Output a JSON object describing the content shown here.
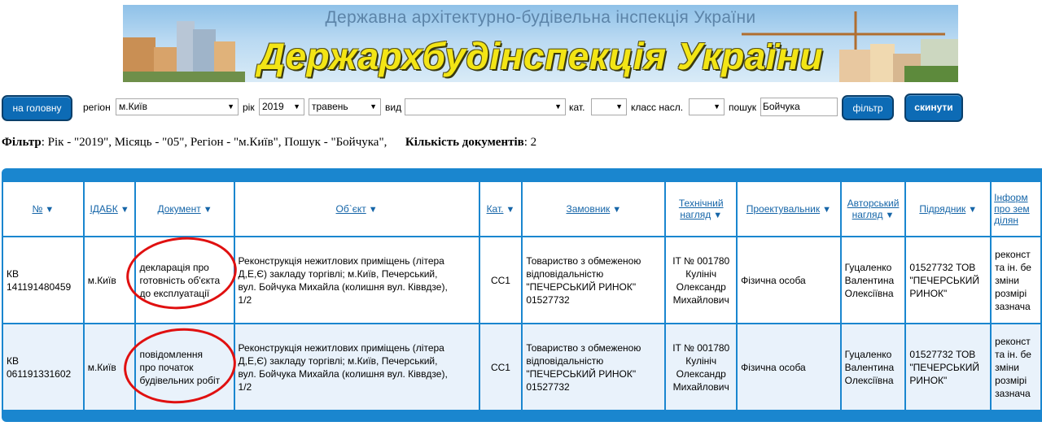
{
  "banner": {
    "subtitle": "Державна архітектурно-будівельна інспекція України",
    "title": "Держархбудінспекція України"
  },
  "filters": {
    "home_button": "на головну",
    "region_label": "регіон",
    "region_value": "м.Київ",
    "year_label": "рік",
    "year_value": "2019",
    "month_value": "травень",
    "type_label": "вид",
    "type_value": "",
    "cat_label": "кат.",
    "cat_value": "",
    "class_label": "класс насл.",
    "class_value": "",
    "search_label": "пошук",
    "search_value": "Бойчука",
    "filter_button": "фільтр",
    "reset_button": "скинути"
  },
  "summary": {
    "filter_label": "Фільтр",
    "filter_text": ": Рік - \"2019\", Місяць - \"05\", Регіон - \"м.Київ\", Пошук - \"Бойчука\",",
    "count_label": "Кількість документів",
    "count_text": ": 2"
  },
  "table": {
    "headers": {
      "num": "№",
      "idabk": "ІДАБК",
      "doc": "Документ",
      "object": "Об`єкт",
      "cat": "Кат.",
      "customer": "Замовник",
      "tech1": "Технічний",
      "tech2": "нагляд",
      "designer": "Проектувальник",
      "author1": "Авторський",
      "author2": "нагляд",
      "contractor": "Підрядник",
      "info1": "Інформ",
      "info2": "про зем",
      "info3": "ділян"
    },
    "rows": [
      {
        "num1": "КВ",
        "num2": "141191480459",
        "idabk": "м.Київ",
        "doc1": "декларація про",
        "doc2": "готовність об'єкта",
        "doc3": "до експлуатації",
        "obj1": "Реконструкція нежитлових приміщень (літера",
        "obj2": "Д,Е,Є) закладу торгівлі; м.Київ, Печерський,",
        "obj3": "вул. Бойчука Михайла (колишня вул. Ківвдзе),",
        "obj4": "1/2",
        "cat": "СС1",
        "cust1": "Товариство з обмеженою",
        "cust2": "відповідальністю",
        "cust3": "\"ПЕЧЕРСЬКИЙ РИНОК\"",
        "cust4": "01527732",
        "tech1": "IT № 001780",
        "tech2": "Кулініч",
        "tech3": "Олександр",
        "tech4": "Михайлович",
        "designer": "Фізична особа",
        "auth1": "Гуцаленко",
        "auth2": "Валентина",
        "auth3": "Олексіївна",
        "contr1": "01527732 ТОВ",
        "contr2": "\"ПЕЧЕРСЬКИЙ",
        "contr3": "РИНОК\"",
        "info1": "реконст",
        "info2": "та ін. бе",
        "info3": "зміни",
        "info4": "розмірі",
        "info5": "зазнача"
      },
      {
        "num1": "КВ",
        "num2": "061191331602",
        "idabk": "м.Київ",
        "doc1": "повідомлення",
        "doc2": "про початок",
        "doc3": "будівельних робіт",
        "obj1": "Реконструкція нежитлових приміщень (літера",
        "obj2": "Д,Е,Є) закладу торгівлі; м.Київ, Печерський,",
        "obj3": "вул. Бойчука Михайла (колишня вул. Ківвдзе),",
        "obj4": "1/2",
        "cat": "СС1",
        "cust1": "Товариство з обмеженою",
        "cust2": "відповідальністю",
        "cust3": "\"ПЕЧЕРСЬКИЙ РИНОК\"",
        "cust4": "01527732",
        "tech1": "IT № 001780",
        "tech2": "Кулініч",
        "tech3": "Олександр",
        "tech4": "Михайлович",
        "designer": "Фізична особа",
        "auth1": "Гуцаленко",
        "auth2": "Валентина",
        "auth3": "Олексіївна",
        "contr1": "01527732 ТОВ",
        "contr2": "\"ПЕЧЕРСЬКИЙ",
        "contr3": "РИНОК\"",
        "info1": "реконст",
        "info2": "та ін. бе",
        "info3": "зміни",
        "info4": "розмірі",
        "info5": "зазнача"
      }
    ]
  },
  "colors": {
    "accent_blue": "#1a86cf",
    "button_blue": "#0d6bb5",
    "header_link": "#1565a8",
    "annotation_red": "#e01010",
    "banner_title_yellow": "#f3e515"
  }
}
